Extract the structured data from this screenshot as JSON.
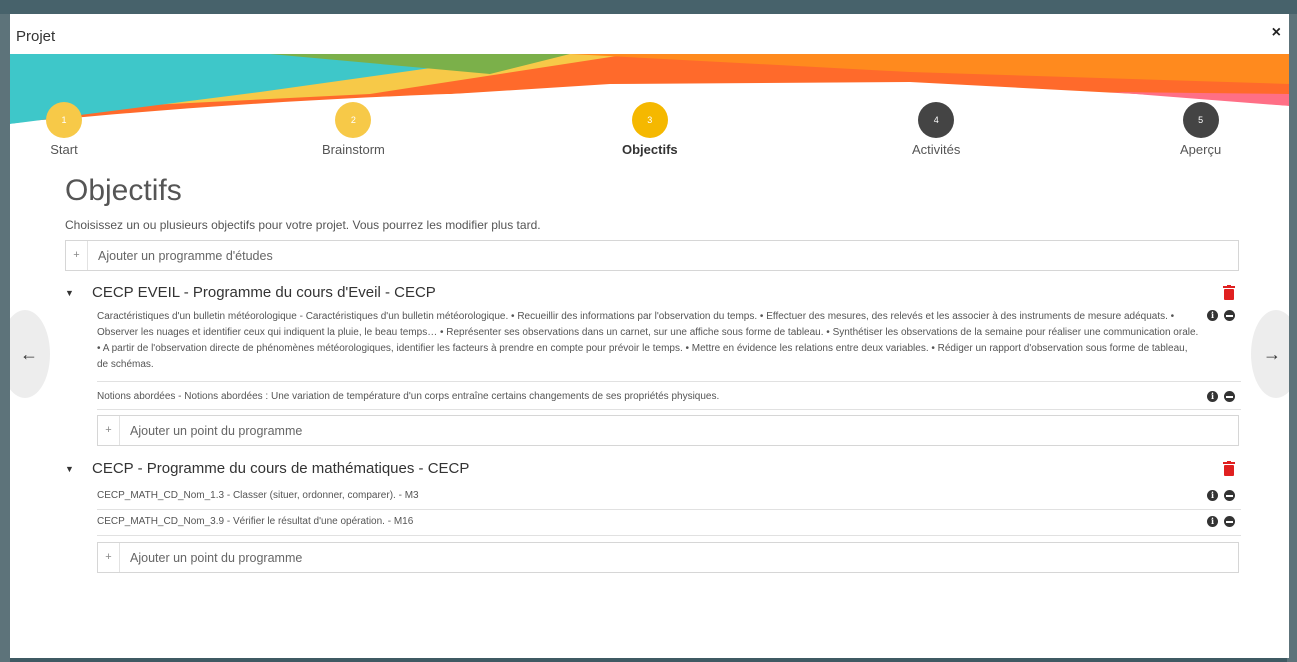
{
  "window": {
    "title": "Projet",
    "close_label": "×"
  },
  "stepper": {
    "steps": [
      {
        "number": "1",
        "label": "Start",
        "state": "done"
      },
      {
        "number": "2",
        "label": "Brainstorm",
        "state": "done"
      },
      {
        "number": "3",
        "label": "Objectifs",
        "state": "active"
      },
      {
        "number": "4",
        "label": "Activités",
        "state": "todo"
      },
      {
        "number": "5",
        "label": "Aperçu",
        "state": "todo"
      }
    ]
  },
  "main": {
    "title": "Objectifs",
    "intro": "Choisissez un ou plusieurs objectifs pour votre projet. Vous pourrez les modifier plus tard.",
    "add_program_label": "Ajouter un programme d'études",
    "add_symbol": "+"
  },
  "sections": [
    {
      "title": "CECP EVEIL - Programme du cours d'Eveil - CECP",
      "items": [
        {
          "text": "Caractéristiques d'un bulletin météorologique - Caractéristiques d'un bulletin météorologique. • Recueillir des informations par l'observation du temps. • Effectuer des mesures, des relevés et les associer à des instruments de mesure adéquats. • Observer les nuages et identifier ceux qui indiquent la pluie, le beau temps… • Représenter ses observations dans un carnet, sur une affiche sous forme de tableau. • Synthétiser les observations de la semaine pour réaliser une communication orale. • A partir de l'observation directe de phénomènes météorologiques, identifier les facteurs à prendre en compte pour prévoir le temps. • Mettre en évidence les relations entre deux variables. • Rédiger un rapport d'observation sous forme de tableau, de schémas."
        },
        {
          "text": "Notions abordées - Notions abordées : Une variation de température d'un corps entraîne certains changements de ses propriétés physiques."
        }
      ],
      "add_point_label": "Ajouter un point du programme"
    },
    {
      "title": "CECP - Programme du cours de mathématiques - CECP",
      "items": [
        {
          "text": "CECP_MATH_CD_Nom_1.3 - Classer (situer, ordonner, comparer). - M3"
        },
        {
          "text": "CECP_MATH_CD_Nom_3.9 - Vérifier le résultat d'une opération. - M16"
        }
      ],
      "add_point_label": "Ajouter un point du programme"
    }
  ],
  "icons": {
    "info": "info-icon",
    "remove": "minus-circle-icon",
    "trash": "trash-icon",
    "caret": "caret-down-icon",
    "arrow_left": "arrow-left-icon",
    "arrow_right": "arrow-right-icon"
  },
  "glyphs": {
    "caret": "▼",
    "info": "i",
    "arrow_left": "←",
    "arrow_right": "→"
  },
  "colors": {
    "accent": "#f5b800",
    "trash": "#e02020",
    "step_todo": "#444444",
    "teal": "#3ec7c9",
    "orange": "#ff6a2b"
  }
}
